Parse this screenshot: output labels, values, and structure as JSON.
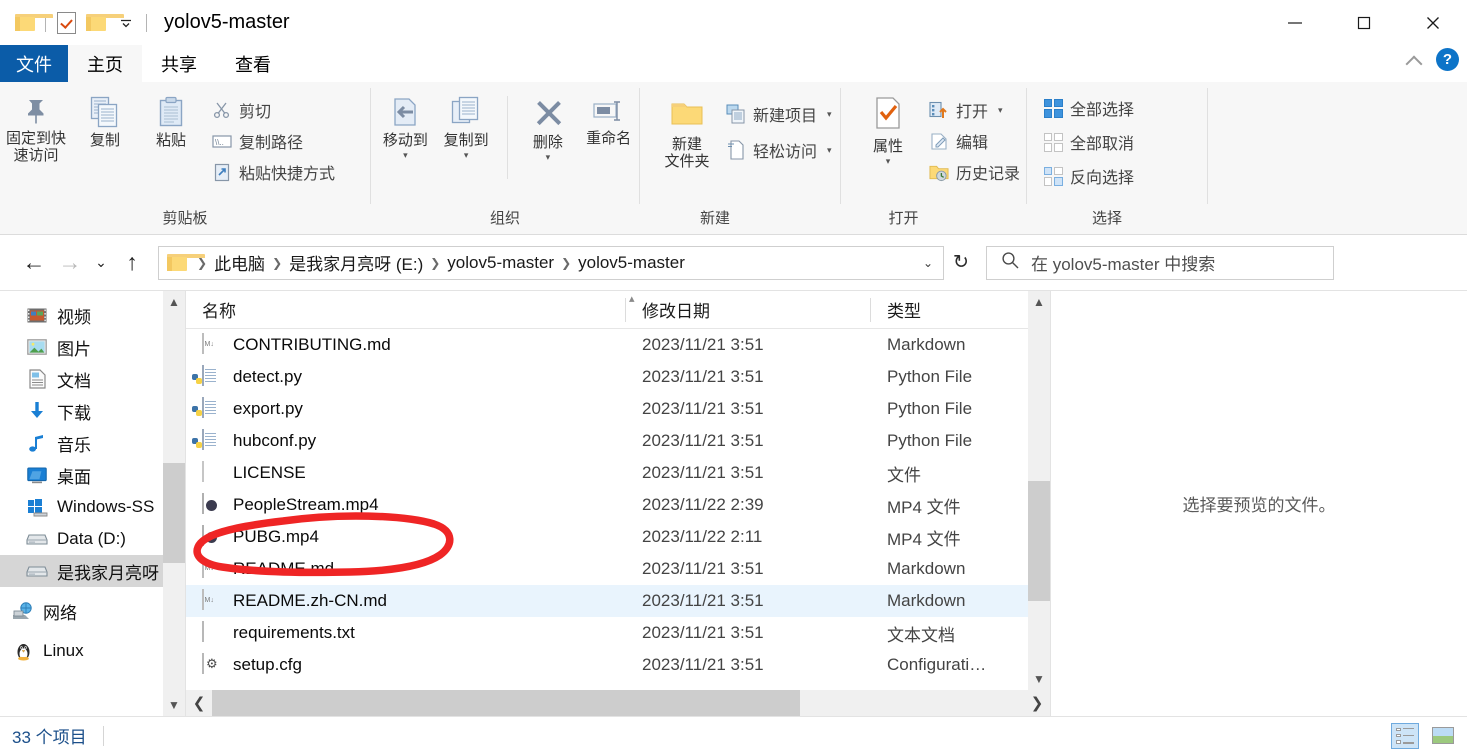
{
  "window": {
    "title": "yolov5-master",
    "controls": {
      "minimize": "—",
      "maximize": "☐",
      "close": "✕"
    },
    "quick_access": [
      "folder-icon",
      "checkbox-doc-icon",
      "folder-icon",
      "chevron-down-icon"
    ]
  },
  "tabs": [
    {
      "label": "文件",
      "state": "file-menu"
    },
    {
      "label": "主页",
      "state": "active"
    },
    {
      "label": "共享",
      "state": "normal"
    },
    {
      "label": "查看",
      "state": "normal"
    }
  ],
  "ribbon": {
    "collapse_icon": "chevron-up-icon",
    "help_label": "?",
    "groups": [
      {
        "label": "剪贴板",
        "big": [
          {
            "label": "固定到快\n速访问",
            "icon": "pin-icon"
          },
          {
            "label": "复制",
            "icon": "copy-icon"
          },
          {
            "label": "粘贴",
            "icon": "paste-icon"
          }
        ],
        "small": [
          {
            "label": "剪切",
            "icon": "scissors-icon"
          },
          {
            "label": "复制路径",
            "icon": "copy-path-icon"
          },
          {
            "label": "粘贴快捷方式",
            "icon": "paste-shortcut-icon"
          }
        ]
      },
      {
        "label": "组织",
        "big": [
          {
            "label": "移动到",
            "icon": "move-to-icon",
            "caret": "▾"
          },
          {
            "label": "复制到",
            "icon": "copy-to-icon",
            "caret": "▾"
          },
          {
            "label": "删除",
            "icon": "delete-x-icon",
            "caret": "▾"
          },
          {
            "label": "重命名",
            "icon": "rename-icon"
          }
        ],
        "small": []
      },
      {
        "label": "新建",
        "big": [
          {
            "label": "新建\n文件夹",
            "icon": "new-folder-icon"
          }
        ],
        "small": [
          {
            "label": "新建项目",
            "icon": "new-item-icon",
            "caret": "▾"
          },
          {
            "label": "轻松访问",
            "icon": "easy-access-icon",
            "caret": "▾"
          }
        ]
      },
      {
        "label": "打开",
        "big": [
          {
            "label": "属性",
            "icon": "properties-icon",
            "caret": "▾"
          }
        ],
        "small": [
          {
            "label": "打开",
            "icon": "open-icon",
            "caret": "▾"
          },
          {
            "label": "编辑",
            "icon": "edit-icon"
          },
          {
            "label": "历史记录",
            "icon": "history-icon"
          }
        ]
      },
      {
        "label": "选择",
        "big": [],
        "small": [
          {
            "label": "全部选择",
            "icon": "select-all-icon"
          },
          {
            "label": "全部取消",
            "icon": "select-none-icon"
          },
          {
            "label": "反向选择",
            "icon": "invert-selection-icon"
          }
        ]
      }
    ]
  },
  "address": {
    "back_icon": "←",
    "forward_icon": "→",
    "recent_icon": "⌄",
    "up_icon": "↑",
    "folder_icon": "folder-icon",
    "crumbs": [
      "此电脑",
      "是我家月亮呀 (E:)",
      "yolov5-master",
      "yolov5-master"
    ],
    "crumb_separator": "❯",
    "dropdown_caret": "⌄",
    "refresh_icon": "↻"
  },
  "search": {
    "icon": "search-icon",
    "placeholder": "在 yolov5-master 中搜索",
    "value": ""
  },
  "navpane": {
    "items": [
      {
        "label": "视频",
        "icon": "videos-icon",
        "selected": false
      },
      {
        "label": "图片",
        "icon": "pictures-icon",
        "selected": false
      },
      {
        "label": "文档",
        "icon": "documents-icon",
        "selected": false
      },
      {
        "label": "下载",
        "icon": "downloads-icon",
        "selected": false
      },
      {
        "label": "音乐",
        "icon": "music-icon",
        "selected": false
      },
      {
        "label": "桌面",
        "icon": "desktop-icon",
        "selected": false
      },
      {
        "label": "Windows-SS",
        "icon": "windows-drive-icon",
        "selected": false
      },
      {
        "label": "Data (D:)",
        "icon": "drive-icon",
        "selected": false
      },
      {
        "label": "是我家月亮呀",
        "icon": "drive-icon",
        "selected": true
      },
      {
        "label": "网络",
        "icon": "network-icon",
        "selected": false
      },
      {
        "label": "Linux",
        "icon": "linux-icon",
        "selected": false
      }
    ]
  },
  "filelist": {
    "columns": [
      "名称",
      "修改日期",
      "类型"
    ],
    "sort_indicator": "ⱏ",
    "rows": [
      {
        "name": "CONTRIBUTING.md",
        "date": "2023/11/21 3:51",
        "type": "Markdown",
        "icon": "markdown-file-icon",
        "hover": false
      },
      {
        "name": "detect.py",
        "date": "2023/11/21 3:51",
        "type": "Python File",
        "icon": "python-file-icon",
        "hover": false
      },
      {
        "name": "export.py",
        "date": "2023/11/21 3:51",
        "type": "Python File",
        "icon": "python-file-icon",
        "hover": false
      },
      {
        "name": "hubconf.py",
        "date": "2023/11/21 3:51",
        "type": "Python File",
        "icon": "python-file-icon",
        "hover": false
      },
      {
        "name": "LICENSE",
        "date": "2023/11/21 3:51",
        "type": "文件",
        "icon": "generic-file-icon",
        "hover": false
      },
      {
        "name": "PeopleStream.mp4",
        "date": "2023/11/22 2:39",
        "type": "MP4 文件",
        "icon": "mp4-file-icon",
        "hover": false
      },
      {
        "name": "PUBG.mp4",
        "date": "2023/11/22 2:11",
        "type": "MP4 文件",
        "icon": "mp4-file-icon",
        "hover": false
      },
      {
        "name": "README.md",
        "date": "2023/11/21 3:51",
        "type": "Markdown",
        "icon": "markdown-file-icon",
        "hover": false
      },
      {
        "name": "README.zh-CN.md",
        "date": "2023/11/21 3:51",
        "type": "Markdown",
        "icon": "markdown-file-icon",
        "hover": true
      },
      {
        "name": "requirements.txt",
        "date": "2023/11/21 3:51",
        "type": "文本文档",
        "icon": "text-file-icon",
        "hover": false
      },
      {
        "name": "setup.cfg",
        "date": "2023/11/21 3:51",
        "type": "Configurati…",
        "icon": "config-file-icon",
        "hover": false
      }
    ]
  },
  "preview": {
    "message": "选择要预览的文件。"
  },
  "status": {
    "count": "33 个项目",
    "views": [
      {
        "name": "details-view",
        "active": true
      },
      {
        "name": "large-icons-view",
        "active": false
      }
    ]
  },
  "annotation": {
    "type": "hand-drawn-ellipse",
    "color": "#ef2525",
    "target": "PUBG.mp4"
  },
  "colors": {
    "file_tab_blue": "#0b5ca8",
    "selection_blue": "#e9f4fd",
    "nav_selected_gray": "#d6d6d6",
    "annotation_red": "#ef2525",
    "help_blue": "#0d74c8"
  }
}
